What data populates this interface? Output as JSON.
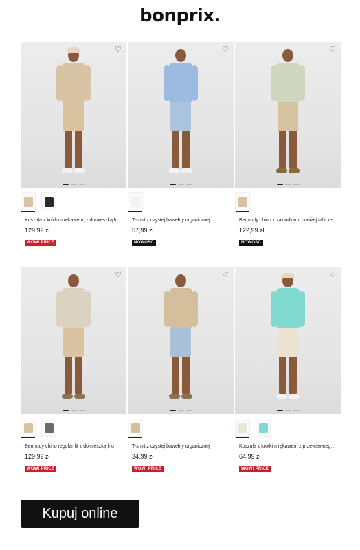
{
  "brand": {
    "logo": "bonprix."
  },
  "products": [
    {
      "name": "Koszula z krótkim rękawem, z domieszką lnu, z ...",
      "price": "129,99 zł",
      "badge": "WOW! PRICE",
      "badge_type": "wow",
      "colors": {
        "shirt": "#d8c4a4",
        "pants": "#d9c39f",
        "shoe": "#f2f2f2",
        "cap": "#e6d8c0"
      },
      "swatches": [
        "#d8c4a4",
        "#2a2a2a"
      ]
    },
    {
      "name": "T-shirt z czystej bawełny organicznej",
      "price": "57,99 zł",
      "badge": "NOWOŚĆ",
      "badge_type": "new",
      "colors": {
        "shirt": "#9dbbe0",
        "pants": "#a9c4dc",
        "shoe": "#f2f2f2",
        "cap": ""
      },
      "swatches": [
        "#f1f1f1"
      ]
    },
    {
      "name": "Bermudy chino z zakładkami poniżej talii, regu...",
      "price": "122,99 zł",
      "badge": "NOWOŚĆ",
      "badge_type": "new",
      "colors": {
        "shirt": "#cfd6c0",
        "pants": "#d8c3a0",
        "shoe": "#8a6a3a",
        "cap": ""
      },
      "swatches": [
        "#d8c3a0"
      ]
    },
    {
      "name": "Bermudy chino regular fit z domieszką lnu",
      "price": "129,99 zł",
      "badge": "WOW! PRICE",
      "badge_type": "wow",
      "colors": {
        "shirt": "#dcd2c2",
        "pants": "#d9c3a0",
        "shoe": "#8a7350",
        "cap": ""
      },
      "swatches": [
        "#d9c3a0",
        "#6b6b6b"
      ]
    },
    {
      "name": "T-shirt z czystej bawełny organicznej",
      "price": "34,99 zł",
      "badge": "WOW! PRICE",
      "badge_type": "wow",
      "colors": {
        "shirt": "#d3bf9c",
        "pants": "#a8c1d6",
        "shoe": "#8a7350",
        "cap": ""
      },
      "swatches": [
        "#d3bf9c"
      ]
    },
    {
      "name": "Koszula z krótkim rękawem z przewiewnego m...",
      "price": "64,99 zł",
      "badge": "WOW! PRICE",
      "badge_type": "wow",
      "colors": {
        "shirt": "#7fd9cf",
        "pants": "#ece2cf",
        "shoe": "#f2f2f2",
        "cap": "#e6d8c0"
      },
      "swatches": [
        "#ece6d8",
        "#7fd9cf"
      ]
    }
  ],
  "cta": {
    "label": "Kupuj online"
  },
  "icons": {
    "favorite": "heart-icon"
  }
}
